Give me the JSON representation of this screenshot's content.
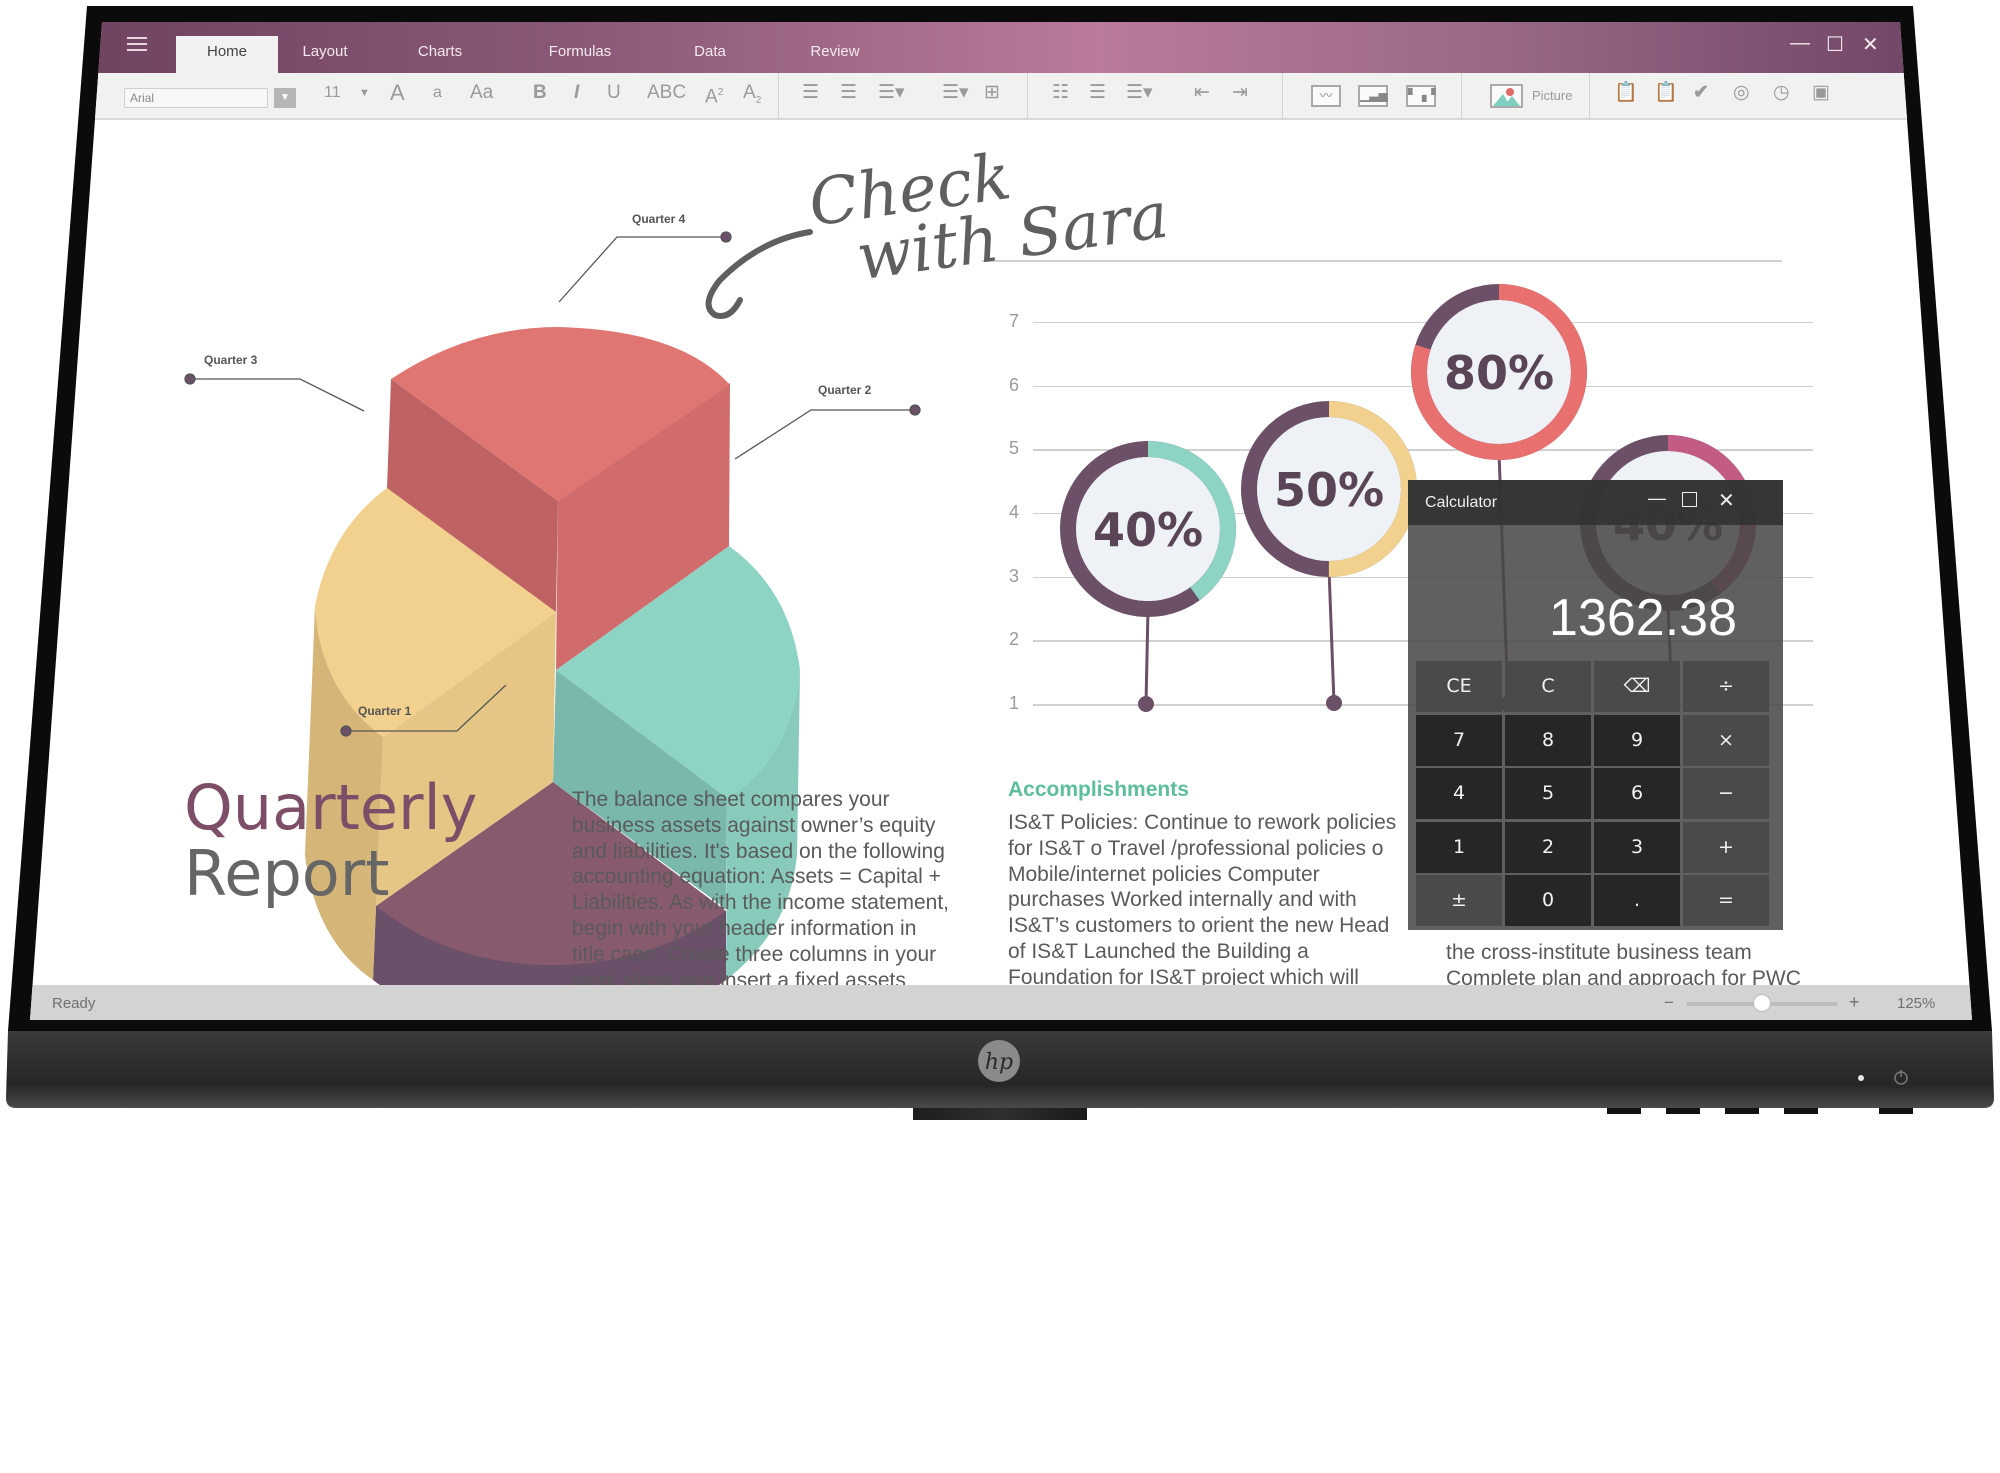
{
  "app": {
    "tabs": [
      "Home",
      "Layout",
      "Charts",
      "Formulas",
      "Data",
      "Review"
    ],
    "active_tab": "Home",
    "window_controls": {
      "minimize": "—",
      "maximize": "☐",
      "close": "✕"
    }
  },
  "toolbar": {
    "font_name": "Arial",
    "font_size": "11",
    "grow_font": "A",
    "shrink_font": "a",
    "change_case": "Aa",
    "bold": "B",
    "italic": "I",
    "underline": "U",
    "strikethrough": "ABC",
    "superscript": "A",
    "superscript_mark": "2",
    "subscript": "A",
    "subscript_mark": "2",
    "picture_label": "Picture",
    "icons": [
      "align-left-icon",
      "align-center-icon",
      "align-right-icon",
      "justify-icon",
      "table-icon",
      "bullet-list-icon",
      "numbered-list-icon",
      "multilevel-list-icon",
      "outdent-icon",
      "indent-icon",
      "line-chart-icon",
      "bar-chart-icon",
      "column-chart-icon",
      "picture-icon",
      "clipboard-check-icon",
      "clipboard-list-icon",
      "checkmark-icon",
      "target-icon",
      "clock-icon",
      "contact-card-icon"
    ]
  },
  "document": {
    "pie_labels": [
      "Quarter 4",
      "Quarter 3",
      "Quarter 2",
      "Quarter 1"
    ],
    "handwritten_note": {
      "line1": "Check",
      "line2": "with Sara"
    },
    "y_ticks": [
      "1",
      "2",
      "3",
      "4",
      "5",
      "6",
      "7"
    ],
    "rings": [
      {
        "label": "40%",
        "value": 40,
        "color": "#8ed4c5"
      },
      {
        "label": "50%",
        "value": 50,
        "color": "#f2d18e"
      },
      {
        "label": "80%",
        "value": 80,
        "color": "#e8706f"
      },
      {
        "label": "40%",
        "value": 40,
        "color": "#c25c85"
      }
    ],
    "ring_base_color": "#6b5068",
    "title_line1": "Quarterly",
    "title_line2": "Report",
    "paragraph_lines": [
      "The balance sheet compares your",
      "business assets against owner’s equity",
      "and liabilities. It's based on the following",
      "accounting equation: Assets = Capital +",
      "Liabilities. As with the income statement,",
      "begin with your header information in",
      "title case. Create three columns in your",
      "work sheet and insert a fixed assets"
    ],
    "accomplishments_heading": "Accomplishments",
    "accomplishments_lines": [
      "IS&T Policies: Continue to rework policies",
      "for IS&T o Travel /professional policies o",
      "Mobile/internet policies Computer",
      "purchases Worked internally and with",
      "IS&T’s customers to orient the new Head",
      "of IS&T Launched the Building a",
      "Foundation for IS&T project which will"
    ],
    "column3_lines": [
      "the cross-institute business team",
      "Complete plan and approach for PWC"
    ]
  },
  "calculator": {
    "title": "Calculator",
    "display": "1362.38",
    "keys": [
      [
        "CE",
        "C",
        "⌫",
        "÷"
      ],
      [
        "7",
        "8",
        "9",
        "×"
      ],
      [
        "4",
        "5",
        "6",
        "−"
      ],
      [
        "1",
        "2",
        "3",
        "+"
      ],
      [
        "±",
        "0",
        ".",
        "="
      ]
    ]
  },
  "status": {
    "text": "Ready",
    "zoom_minus": "−",
    "zoom_plus": "+",
    "zoom_level": "125%",
    "zoom_slider_fraction": 0.5
  },
  "monitor": {
    "brand": "hp"
  }
}
